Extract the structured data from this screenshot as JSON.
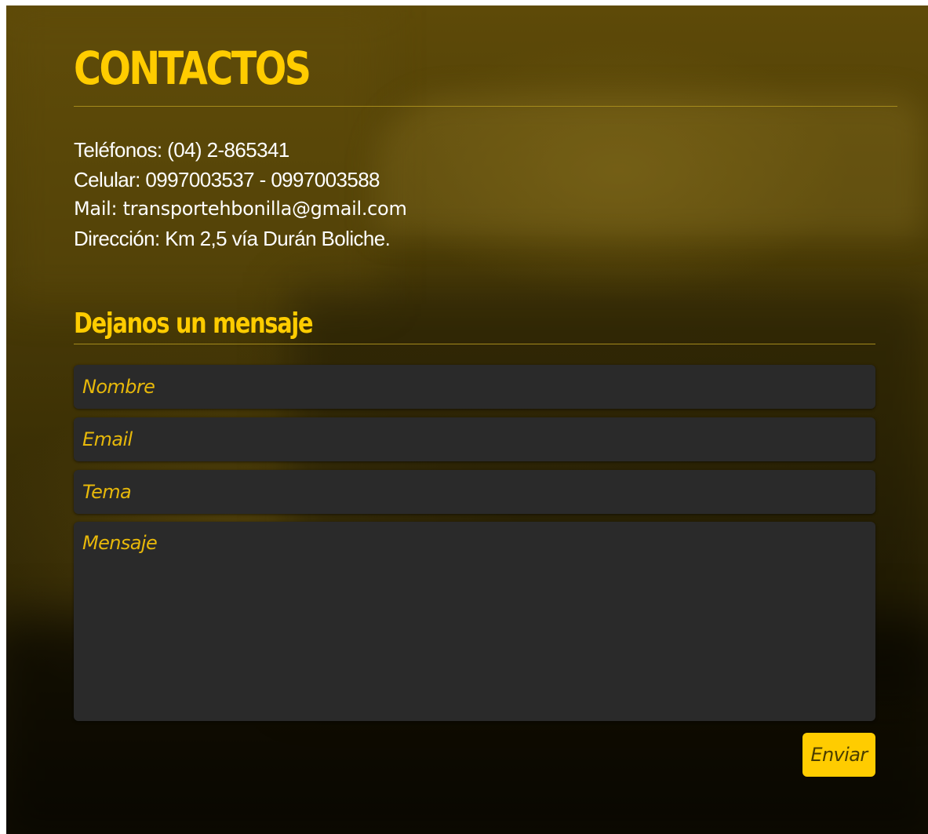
{
  "contact": {
    "title": "CONTACTOS",
    "phone": "Teléfonos: (04) 2-865341",
    "mobile": "Celular: 0997003537 - 0997003588",
    "mail": "Mail: transportehbonilla@gmail.com",
    "address": "Dirección: Km 2,5 vía Durán Boliche."
  },
  "form": {
    "title": "Dejanos un mensaje",
    "name_placeholder": "Nombre",
    "email_placeholder": "Email",
    "subject_placeholder": "Tema",
    "message_placeholder": "Mensaje",
    "submit_label": "Enviar"
  },
  "colors": {
    "accent": "#ffcc00",
    "field_background": "#2a2a2a",
    "text": "#ffffff"
  }
}
